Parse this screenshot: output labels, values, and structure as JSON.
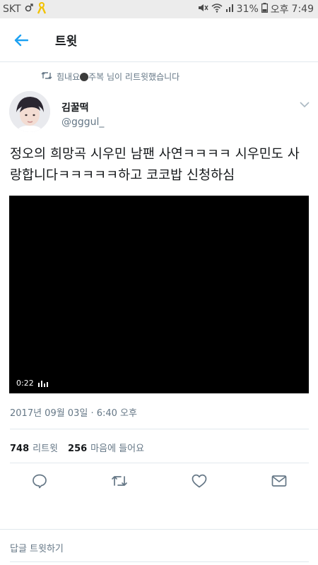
{
  "status_bar": {
    "carrier": "SKT",
    "battery_percent": "31%",
    "time_prefix": "오후",
    "time": "7:49"
  },
  "header": {
    "title": "트윗",
    "back_icon": "arrow-left-icon"
  },
  "retweet_context": {
    "text_before": "힘내요",
    "text_after": "주복 님이 리트윗했습니다"
  },
  "tweet": {
    "display_name": "김꿀떡",
    "handle": "@gggul_",
    "text": "정오의 희망곡 시우민 남팬 사연ㅋㅋㅋㅋ 시우민도 사랑합니다ㅋㅋㅋㅋㅋ하고 코코밥 신청하심",
    "video_time": "0:22",
    "timestamp": "2017년 09월 03일 · 6:40 오후"
  },
  "stats": {
    "retweets_count": "748",
    "retweets_label": "리트윗",
    "likes_count": "256",
    "likes_label": "마음에 들어요"
  },
  "actions": [
    "reply-icon",
    "retweet-icon",
    "like-heart-icon",
    "share-mail-icon"
  ],
  "reply_bar": {
    "placeholder": "답글 트윗하기"
  },
  "colors": {
    "accent": "#1da1f2",
    "text_secondary": "#657786",
    "divider": "#e1e8ed",
    "status_bar": "#ececec"
  }
}
